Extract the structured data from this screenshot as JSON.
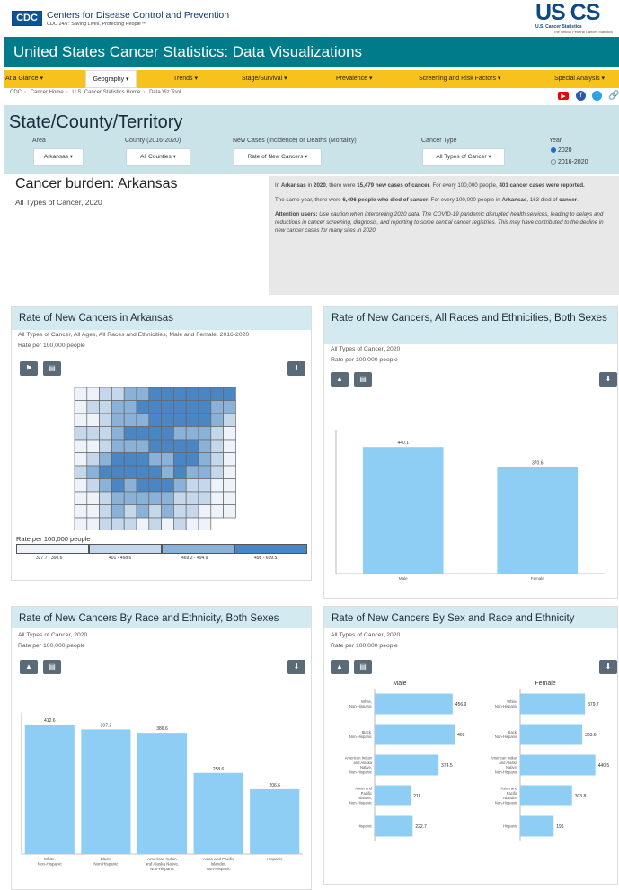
{
  "header": {
    "cdc_logo": "CDC",
    "cdc_name": "Centers for Disease Control and Prevention",
    "cdc_tagline": "CDC 24/7: Saving Lives, Protecting People™",
    "uscs_logo": "US CS",
    "uscs_sub": "U.S. Cancer Statistics",
    "uscs_sub2": "The Official Federal Cancer Statistics",
    "title": "United States Cancer Statistics: Data Visualizations"
  },
  "nav": {
    "items": [
      {
        "label": "At a Glance ▾"
      },
      {
        "label": "Geography ▾"
      },
      {
        "label": "Trends ▾"
      },
      {
        "label": "Stage/Survival ▾"
      },
      {
        "label": "Prevalence ▾"
      },
      {
        "label": "Screening and Risk Factors ▾"
      },
      {
        "label": "Special Analysis ▾"
      }
    ],
    "active_color": "#ffffff",
    "bar_color": "#f8c21c"
  },
  "breadcrumbs": [
    "CDC",
    "Cancer Home",
    "U.S. Cancer Statistics Home",
    "Data Viz Tool"
  ],
  "social_icons": [
    "youtube-icon",
    "facebook-icon",
    "twitter-icon",
    "link-icon"
  ],
  "page_title": "State/County/Territory",
  "filters": {
    "area": {
      "label": "Area",
      "value": "Arkansas ▾"
    },
    "county": {
      "label": "County (2016-2020)",
      "value": "All Counties ▾"
    },
    "measure": {
      "label": "New Cases (Incidence) or Deaths (Mortality)",
      "value": "Rate of New Cancers ▾"
    },
    "cancer": {
      "label": "Cancer Type",
      "value": "All Types of Cancer ▾"
    },
    "year": {
      "label": "Year",
      "options": [
        "2020",
        "2016-2020"
      ],
      "selected": "2020"
    }
  },
  "burden": {
    "title": "Cancer burden: Arkansas",
    "subtitle": "All Types of Cancer, 2020"
  },
  "summary": {
    "p1_a": "In ",
    "p1_state": "Arkansas",
    "p1_b": " in ",
    "p1_year": "2020",
    "p1_c": ", there were ",
    "p1_cases": "15,479 new cases of cancer",
    "p1_d": ". For every 100,000 people, ",
    "p1_rate": "401 cancer cases were reported.",
    "p2_a": "The same year, there were ",
    "p2_deaths": "6,496 people who died of cancer",
    "p2_b": ". For every 100,000 people in ",
    "p2_state": "Arkansas",
    "p2_c": ", 163 died of ",
    "p2_cancer": "cancer",
    "p2_d": ".",
    "p3_label": "Attention users:",
    "p3_text": " Use caution when interpreting 2020 data. The COVID-19 pandemic disrupted health services, leading to delays and reductions in cancer screening, diagnosis, and reporting to some central cancer registries. This may have contributed to the decline in new cancer cases for many sites in 2020."
  },
  "panels": {
    "map": {
      "title": "Rate of New Cancers in Arkansas",
      "sub1": "All Types of Cancer, All Ages, All Races and Ethnicities, Male and Female, 2016-2020",
      "sub2": "Rate per 100,000 people",
      "legend_title": "Rate per 100,000 people",
      "legend": [
        {
          "label": "327.7 - 398.6",
          "color": "#eef3fa"
        },
        {
          "label": "401 - 468.6",
          "color": "#c5d8eb"
        },
        {
          "label": "469.2 - 494.9",
          "color": "#8ab2d8"
        },
        {
          "label": "498 - 609.5",
          "color": "#4a86c4"
        }
      ]
    },
    "sex": {
      "title": "Rate of New Cancers, All Races and Ethnicities, Both Sexes",
      "sub1": "All Types of Cancer, 2020",
      "sub2": "Rate per 100,000 people"
    },
    "race": {
      "title": "Rate of New Cancers By Race and Ethnicity, Both Sexes",
      "sub1": "All Types of Cancer, 2020",
      "sub2": "Rate per 100,000 people"
    },
    "sexrace": {
      "title": "Rate of New Cancers By Sex and Race and Ethnicity",
      "sub1": "All Types of Cancer, 2020",
      "sub2": "Rate per 100,000 people"
    }
  },
  "chart_data": [
    {
      "type": "bar",
      "id": "sex",
      "categories": [
        "Male",
        "Female"
      ],
      "values": [
        440.1,
        370.6
      ],
      "ylim": [
        0,
        500
      ],
      "bar_color": "#8ecef5"
    },
    {
      "type": "bar",
      "id": "race",
      "categories": [
        "White, Non-Hispanic",
        "Black, Non-Hispanic",
        "American Indian and Alaska Native, Non-Hispanic",
        "Asian and Pacific Islander, Non-Hispanic",
        "Hispanic"
      ],
      "values": [
        412.6,
        397.2,
        386.6,
        258.6,
        206.6
      ],
      "ylim": [
        0,
        450
      ],
      "bar_color": "#8ecef5"
    },
    {
      "type": "bar",
      "id": "sexrace",
      "orientation": "horizontal",
      "categories": [
        "White, Non-Hispanic",
        "Black, Non-Hispanic",
        "American Indian and Alaska Native, Non-Hispanic",
        "Asian and Pacific Islander, Non-Hispanic",
        "Hispanic"
      ],
      "series": [
        {
          "name": "Male",
          "values": [
            456.9,
            469.0,
            374.5,
            211.0,
            222.7
          ]
        },
        {
          "name": "Female",
          "values": [
            379.7,
            363.6,
            440.5,
            303.8,
            196.0
          ]
        }
      ],
      "ylim": [
        0,
        500
      ],
      "bar_color": "#8ecef5"
    }
  ]
}
